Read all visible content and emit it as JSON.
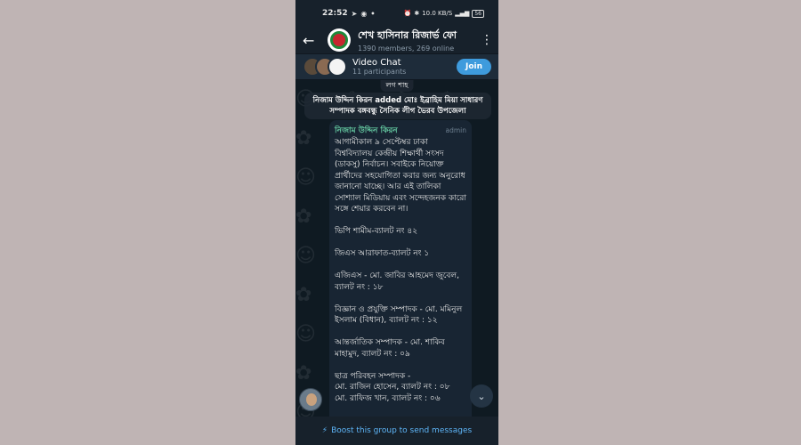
{
  "status_bar": {
    "time": "22:52",
    "net_speed": "10.0 KB/S",
    "battery": "56"
  },
  "header": {
    "title": "শেখ হাসিনার রিজার্ভ ফো",
    "subtitle": "1390 members, 269 online"
  },
  "video_chat": {
    "title": "Video Chat",
    "participants": "11 participants",
    "join_label": "Join"
  },
  "chat": {
    "service_top": "লগ শাহ",
    "service_message": "নিজাম উদ্দিন কিরন added মোঃ ইব্রাহিম মিয়া সাধারণ সম্পাদক বঙ্গবন্ধু সৈনিক লীগ ভৈরব উপজেলা",
    "message": {
      "sender": "নিজাম উদ্দিন কিরন",
      "role": "admin",
      "text": "আগামীকাল ৯ সেপ্টেম্বর ঢাকা বিশ্ববিদ্যালয় কেন্দ্রীয় শিক্ষার্থী সংসদ (ডাকসু) নির্বাচন। সবাইকে নিয়োক্ত প্রার্থীদের সহযোগিতা করার জন্য অনুরোধ জানানো যাচ্ছে। আর এই তালিকা সোশ্যাল মিডিয়ায় এবং সন্দেহজনক কারো সঙ্গে শেয়ার করবেন না।\n\nভিপি শামীম-ব্যালট নং ৪২\n\nজিএস আরাফাত-ব্যালট নং ১\n\nএজিএস - মো. জাবির আহমেদ জুবেল, ব্যালট নং : ১৮\n\nবিজ্ঞান ও প্রযুক্তি সম্পাদক - মো. মমিনুল ইসলাম (বিধান), ব্যালট নং : ১২\n\nআন্তর্জাতিক সম্পাদক - মো. শাকিব মাহামুদ, ব্যালট নং : ০৯\n\nছাত্র পরিবহন সম্পাদক -\nমো. রাজিন হোসেন, ব্যালট নং : ০৮\nমো. রাফিজ খান, ব্যালট নং : ০৬"
    }
  },
  "bottom_bar": {
    "boost_label": "Boost this group to send messages"
  }
}
